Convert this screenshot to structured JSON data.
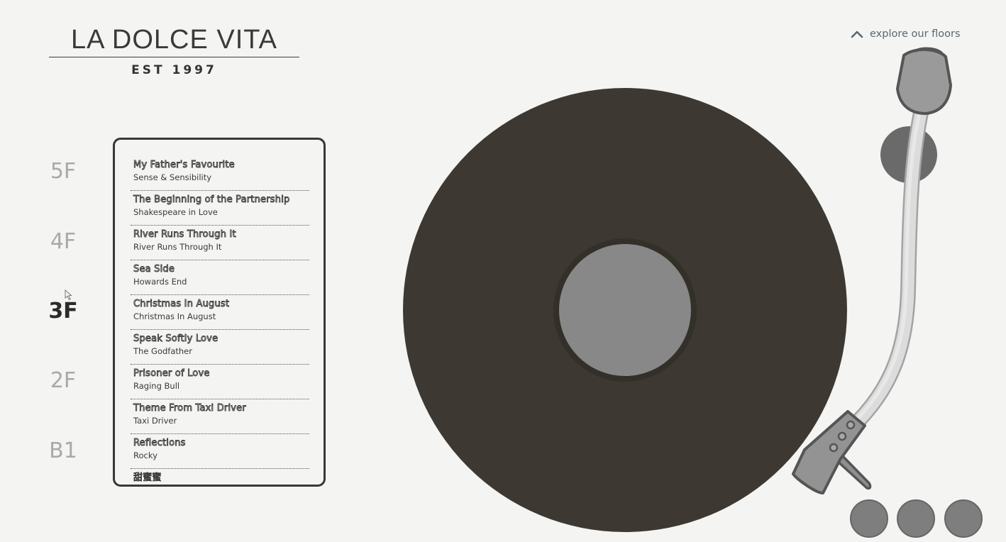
{
  "brand": {
    "title": "LA DOLCE VITA",
    "subtitle": "EST 1997"
  },
  "nav": {
    "explore_label": "explore our floors",
    "explore_icon": "chevron-up-icon"
  },
  "floors": [
    {
      "label": "5F",
      "active": false
    },
    {
      "label": "4F",
      "active": false
    },
    {
      "label": "3F",
      "active": true
    },
    {
      "label": "2F",
      "active": false
    },
    {
      "label": "B1",
      "active": false
    }
  ],
  "playlist": [
    {
      "title": "My Father's Favourite",
      "film": "Sense & Sensibility"
    },
    {
      "title": "The Beginning of the Partnership",
      "film": "Shakespeare in Love"
    },
    {
      "title": "River Runs Through It",
      "film": "River Runs Through It"
    },
    {
      "title": "Sea Side",
      "film": "Howards End"
    },
    {
      "title": "Christmas In August",
      "film": "Christmas In August"
    },
    {
      "title": "Speak Softly Love",
      "film": "The Godfather"
    },
    {
      "title": "Prisoner of Love",
      "film": "Raging Bull"
    },
    {
      "title": "Theme From Taxi Driver",
      "film": "Taxi Driver"
    },
    {
      "title": "Reflections",
      "film": "Rocky"
    },
    {
      "title": "甜蜜蜜",
      "film": ""
    }
  ],
  "colors": {
    "background": "#f4f4f2",
    "record": "#3d3932",
    "label": "#888888",
    "arm": "#d9d9d9",
    "headshell": "#909090",
    "control": "#7e7e7e"
  },
  "controls": [
    {
      "name": "control-button-1"
    },
    {
      "name": "control-button-2"
    },
    {
      "name": "control-button-3"
    }
  ]
}
